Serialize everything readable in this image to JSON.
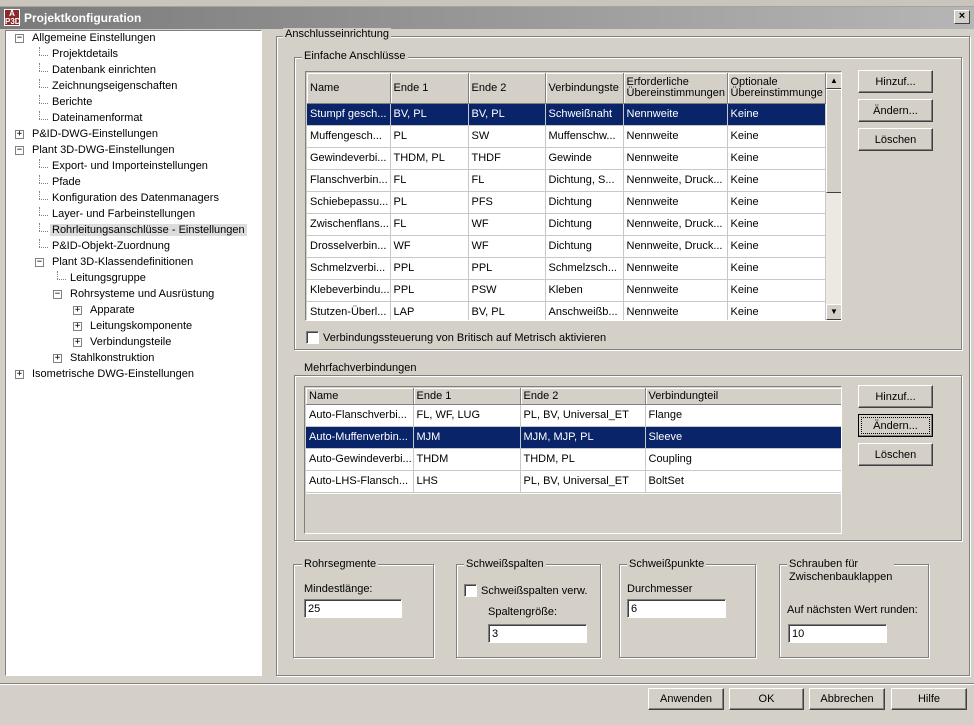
{
  "window": {
    "title": "Projektkonfiguration",
    "icon_text_top": "A",
    "icon_text_bottom": "P3D",
    "close_label": "×"
  },
  "tree": [
    {
      "label": "Allgemeine Einstellungen",
      "level": 0,
      "expander": "−"
    },
    {
      "label": "Projektdetails",
      "level": 1
    },
    {
      "label": "Datenbank einrichten",
      "level": 1
    },
    {
      "label": "Zeichnungseigenschaften",
      "level": 1
    },
    {
      "label": "Berichte",
      "level": 1
    },
    {
      "label": "Dateinamenformat",
      "level": 1
    },
    {
      "label": "P&ID-DWG-Einstellungen",
      "level": 0,
      "expander": "+"
    },
    {
      "label": "Plant 3D-DWG-Einstellungen",
      "level": 0,
      "expander": "−"
    },
    {
      "label": "Export- und Importeinstellungen",
      "level": 1
    },
    {
      "label": "Pfade",
      "level": 1
    },
    {
      "label": "Konfiguration des Datenmanagers",
      "level": 1
    },
    {
      "label": "Layer- und Farbeinstellungen",
      "level": 1
    },
    {
      "label": "Rohrleitungsanschlüsse - Einstellungen",
      "level": 1,
      "selected": true
    },
    {
      "label": "P&ID-Objekt-Zuordnung",
      "level": 1
    },
    {
      "label": "Plant 3D-Klassendefinitionen",
      "level": 1,
      "expander": "−"
    },
    {
      "label": "Leitungsgruppe",
      "level": 2
    },
    {
      "label": "Rohrsysteme und Ausrüstung",
      "level": 2,
      "expander": "−"
    },
    {
      "label": "Apparate",
      "level": 3,
      "expander": "+"
    },
    {
      "label": "Leitungskomponente",
      "level": 3,
      "expander": "+"
    },
    {
      "label": "Verbindungsteile",
      "level": 3,
      "expander": "+"
    },
    {
      "label": "Stahlkonstruktion",
      "level": 2,
      "expander": "+"
    },
    {
      "label": "Isometrische DWG-Einstellungen",
      "level": 0,
      "expander": "+"
    }
  ],
  "main": {
    "title": "Anschlusseinrichtung",
    "simple": {
      "title": "Einfache Anschlüsse",
      "headers": [
        "Name",
        "Ende 1",
        "Ende 2",
        "Verbindungsteil",
        "Erforderliche Übereinstimmungen",
        "Optionale Übereinstimmungen"
      ],
      "header_line1": [
        "Name",
        "Ende 1",
        "Ende 2",
        "Verbindungste",
        "Erforderliche",
        "Optionale"
      ],
      "header_line2": [
        "",
        "",
        "",
        "",
        "Übereinstimmungen",
        "Übereinstimmunge"
      ],
      "rows": [
        [
          "Stumpf gesch...",
          "BV, PL",
          "BV, PL",
          "Schweißnaht",
          "Nennweite",
          "Keine"
        ],
        [
          "Muffengesch...",
          "PL",
          "SW",
          "Muffenschw...",
          "Nennweite",
          "Keine"
        ],
        [
          "Gewindeverbi...",
          "THDM, PL",
          "THDF",
          "Gewinde",
          "Nennweite",
          "Keine"
        ],
        [
          "Flanschverbin...",
          "FL",
          "FL",
          "Dichtung, S...",
          "Nennweite, Druck...",
          "Keine"
        ],
        [
          "Schiebepassu...",
          "PL",
          "PFS",
          "Dichtung",
          "Nennweite",
          "Keine"
        ],
        [
          "Zwischenflans...",
          "FL",
          "WF",
          "Dichtung",
          "Nennweite, Druck...",
          "Keine"
        ],
        [
          "Drosselverbin...",
          "WF",
          "WF",
          "Dichtung",
          "Nennweite, Druck...",
          "Keine"
        ],
        [
          "Schmelzverbi...",
          "PPL",
          "PPL",
          "Schmelzsch...",
          "Nennweite",
          "Keine"
        ],
        [
          "Klebeverbindu...",
          "PPL",
          "PSW",
          "Kleben",
          "Nennweite",
          "Keine"
        ],
        [
          "Stutzen-Überl...",
          "LAP",
          "BV, PL",
          "Anschweißb...",
          "Nennweite",
          "Keine"
        ]
      ],
      "selected_row": 0,
      "checkbox_label": "Verbindungssteuerung von Britisch auf Metrisch aktivieren",
      "checkbox_checked": false
    },
    "multi": {
      "title": "Mehrfachverbindungen",
      "headers": [
        "Name",
        "Ende 1",
        "Ende 2",
        "Verbindungteil"
      ],
      "rows": [
        [
          "Auto-Flanschverbi...",
          "FL, WF, LUG",
          "PL, BV, Universal_ET",
          "Flange"
        ],
        [
          "Auto-Muffenverbin...",
          "MJM",
          "MJM, MJP, PL",
          "Sleeve"
        ],
        [
          "Auto-Gewindeverbi...",
          "THDM",
          "THDM, PL",
          "Coupling"
        ],
        [
          "Auto-LHS-Flansch...",
          "LHS",
          "PL, BV, Universal_ET",
          "BoltSet"
        ]
      ],
      "selected_row": 1
    },
    "buttons": {
      "add": "Hinzuf...",
      "edit": "Ändern...",
      "delete": "Löschen"
    },
    "rohrsegmente": {
      "title": "Rohrsegmente",
      "label": "Mindestlänge:",
      "value": "25"
    },
    "schweissspalten": {
      "title": "Schweißspalten",
      "checkbox_label": "Schweißspalten verw.",
      "checked": false,
      "size_label": "Spaltengröße:",
      "size_value": "3"
    },
    "schweisspunkte": {
      "title": "Schweißpunkte",
      "label": "Durchmesser",
      "value": "6"
    },
    "schrauben": {
      "title_line1": "Schrauben für",
      "title_line2": "Zwischenbauklappen",
      "label": "Auf nächsten Wert runden:",
      "value": "10"
    }
  },
  "footer": {
    "apply": "Anwenden",
    "ok": "OK",
    "cancel": "Abbrechen",
    "help": "Hilfe"
  }
}
